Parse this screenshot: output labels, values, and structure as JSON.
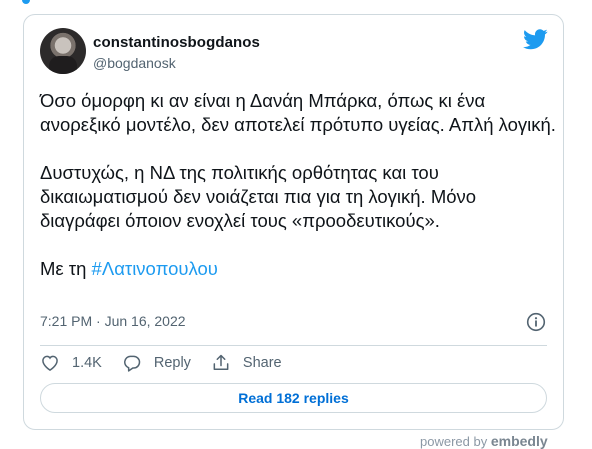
{
  "tweet": {
    "username": "constantinosbogdanos",
    "handle": "@bogdanosk",
    "paragraphs": [
      "Όσο όμορφη κι αν είναι η Δανάη Μπάρκα, όπως κι ένα ανορεξικό μοντέλο, δεν αποτελεί πρότυπο υγείας. Απλή λογική.",
      "Δυστυχώς, η ΝΔ της πολιτικής ορθότητας και του δικαιωματισμού δεν νοιάζεται πια για τη λογική. Μόνο διαγράφει όποιον ενοχλεί τους «προοδευτικούς»."
    ],
    "closing_prefix": "Με τη ",
    "hashtag": "#Λατινοπουλου",
    "timestamp": "7:21 PM · Jun 16, 2022"
  },
  "actions": {
    "likes": "1.4K",
    "reply_label": "Reply",
    "share_label": "Share"
  },
  "read_replies_label": "Read 182 replies",
  "footer": {
    "powered_prefix": "powered by",
    "powered_brand": "embedly"
  },
  "colors": {
    "accent": "#1d9bf0",
    "link_button": "#006fd6",
    "secondary_text": "#536471",
    "border": "#cfd9de"
  },
  "icons": [
    "twitter-bird-icon",
    "info-icon",
    "heart-icon",
    "reply-bubble-icon",
    "share-icon"
  ]
}
